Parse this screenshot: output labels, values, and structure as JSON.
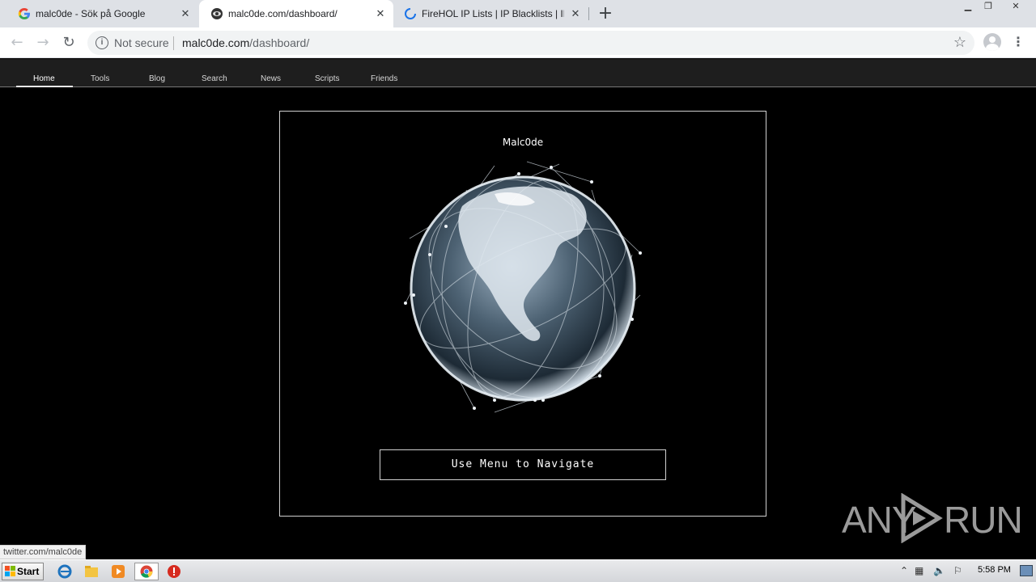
{
  "browser": {
    "tabs": [
      {
        "title": "malc0de - Sök på Google",
        "favicon": "google-g-icon",
        "active": false
      },
      {
        "title": "malc0de.com/dashboard/",
        "favicon": "site-icon",
        "active": true
      },
      {
        "title": "FireHOL IP Lists | IP Blacklists | IP Bl",
        "favicon": "loading-spinner-icon",
        "active": false
      }
    ],
    "new_tab_label": "+",
    "address": {
      "security_label": "Not secure",
      "host": "malc0de.com",
      "path": "/dashboard/"
    }
  },
  "site": {
    "nav": [
      "Home",
      "Tools",
      "Blog",
      "Search",
      "News",
      "Scripts",
      "Friends"
    ],
    "active_nav": "Home",
    "panel_title": "Malc0de",
    "cta_label": "Use Menu to Navigate"
  },
  "status_url": "twitter.com/malc0de",
  "watermark": {
    "left": "ANY",
    "right": "RUN"
  },
  "taskbar": {
    "start_label": "Start",
    "clock": "5:58 PM"
  }
}
